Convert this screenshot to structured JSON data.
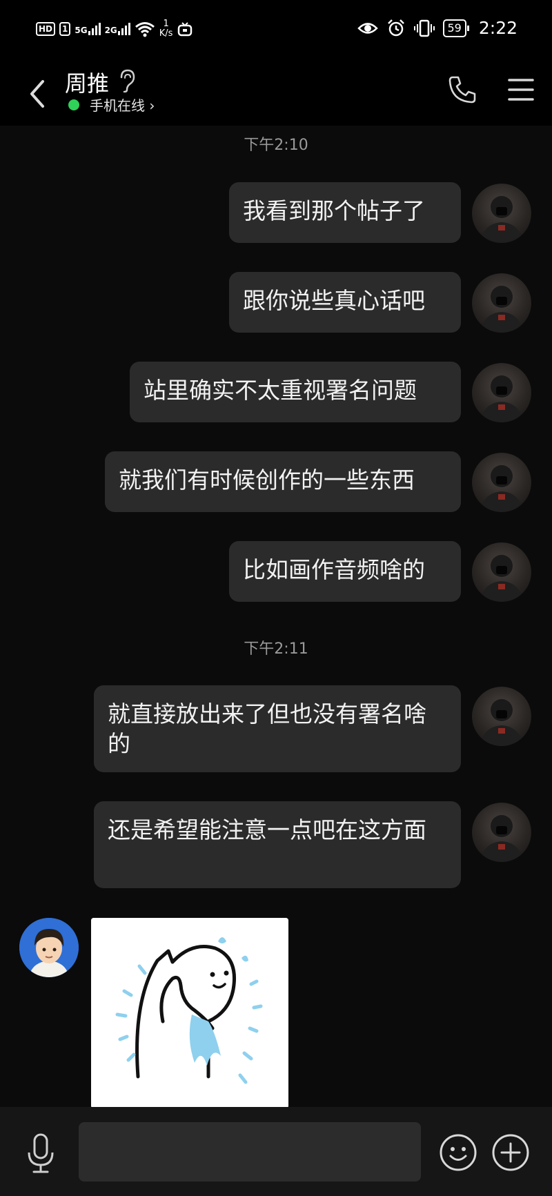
{
  "status_bar": {
    "hd": "HD",
    "sim": "1",
    "net1": "5G",
    "net2": "2G",
    "speed_value": "1",
    "speed_unit": "K/s",
    "battery": "59",
    "time": "2:22"
  },
  "header": {
    "contact_name": "周推",
    "online_status": "手机在线",
    "online_chevron": "›"
  },
  "chat": {
    "timestamps": [
      "下午2:10",
      "下午2:11"
    ],
    "messages": [
      {
        "text": "我看到那个帖子了"
      },
      {
        "text": "跟你说些真心话吧"
      },
      {
        "text": "站里确实不太重视署名问题"
      },
      {
        "text": "就我们有时候创作的一些东西"
      },
      {
        "text": "比如画作音频啥的"
      },
      {
        "text": "就直接放出来了但也没有署名啥的"
      },
      {
        "text": "还是希望能注意一点吧在这方面"
      }
    ]
  },
  "input_bar": {
    "placeholder": ""
  },
  "colors": {
    "background": "#0b0b0b",
    "bubble": "#2b2b2b",
    "online_dot": "#2fd158",
    "timestamp": "#9a9a9a"
  },
  "icons": [
    "back-chevron-icon",
    "ear-icon",
    "phone-icon",
    "menu-icon",
    "mic-icon",
    "emoji-icon",
    "plus-icon"
  ]
}
